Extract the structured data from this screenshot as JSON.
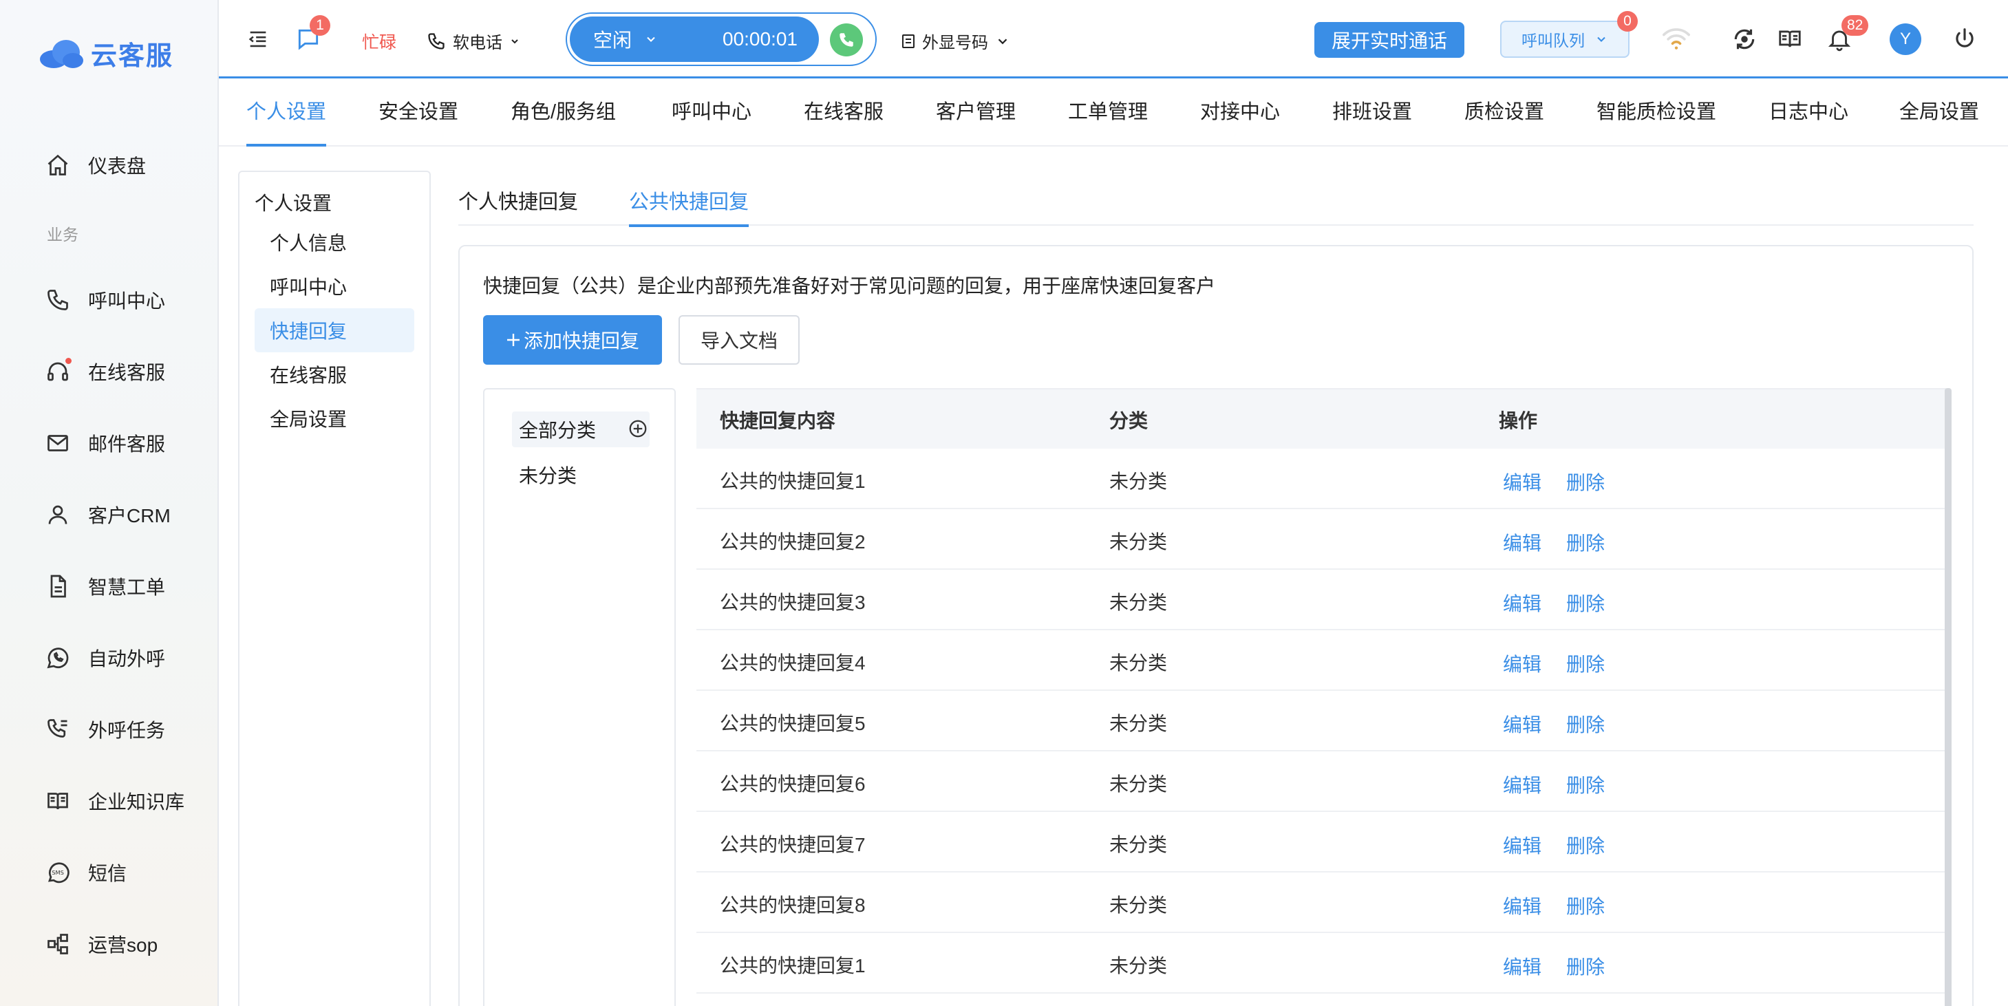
{
  "app": {
    "logo_text": "云客服",
    "brand_color": "#3a8ee6"
  },
  "sidebar": {
    "items": [
      {
        "label": "仪表盘",
        "icon": "home-icon"
      },
      {
        "label": "呼叫中心",
        "icon": "phone-icon"
      },
      {
        "label": "在线客服",
        "icon": "headset-icon"
      },
      {
        "label": "邮件客服",
        "icon": "mail-icon"
      },
      {
        "label": "客户CRM",
        "icon": "user-icon"
      },
      {
        "label": "智慧工单",
        "icon": "document-icon"
      },
      {
        "label": "自动外呼",
        "icon": "whatsapp-icon"
      },
      {
        "label": "外呼任务",
        "icon": "phone-list-icon"
      },
      {
        "label": "企业知识库",
        "icon": "book-icon"
      },
      {
        "label": "短信",
        "icon": "sms-icon"
      },
      {
        "label": "运营sop",
        "icon": "flow-icon"
      }
    ],
    "section_business": "业务"
  },
  "header": {
    "message_badge": "1",
    "status": "忙碌",
    "softphone": "软电话",
    "call_state": "空闲",
    "call_timer": "00:00:01",
    "outbound_number": "外显号码",
    "realtime_button": "展开实时通话",
    "queue_label": "呼叫队列",
    "queue_badge": "0",
    "notification_badge": "82",
    "avatar_letter": "Y"
  },
  "module_tabs": [
    "个人设置",
    "安全设置",
    "角色/服务组",
    "呼叫中心",
    "在线客服",
    "客户管理",
    "工单管理",
    "对接中心",
    "排班设置",
    "质检设置",
    "智能质检设置",
    "日志中心",
    "全局设置"
  ],
  "subnav": {
    "title": "个人设置",
    "items": [
      "个人信息",
      "呼叫中心",
      "快捷回复",
      "在线客服",
      "全局设置"
    ],
    "active": "快捷回复"
  },
  "sub_tabs": [
    "个人快捷回复",
    "公共快捷回复"
  ],
  "panel": {
    "description": "快捷回复（公共）是企业内部预先准备好对于常见问题的回复，用于座席快速回复客户",
    "add_button": "添加快捷回复",
    "import_button": "导入文档",
    "categories": {
      "all": "全部分类",
      "uncategorized": "未分类"
    },
    "table": {
      "headers": [
        "快捷回复内容",
        "分类",
        "操作"
      ],
      "rows": [
        {
          "content": "公共的快捷回复1",
          "category": "未分类"
        },
        {
          "content": "公共的快捷回复2",
          "category": "未分类"
        },
        {
          "content": "公共的快捷回复3",
          "category": "未分类"
        },
        {
          "content": "公共的快捷回复4",
          "category": "未分类"
        },
        {
          "content": "公共的快捷回复5",
          "category": "未分类"
        },
        {
          "content": "公共的快捷回复6",
          "category": "未分类"
        },
        {
          "content": "公共的快捷回复7",
          "category": "未分类"
        },
        {
          "content": "公共的快捷回复8",
          "category": "未分类"
        },
        {
          "content": "公共的快捷回复1",
          "category": "未分类"
        }
      ],
      "actions": {
        "edit": "编辑",
        "delete": "删除"
      }
    }
  }
}
